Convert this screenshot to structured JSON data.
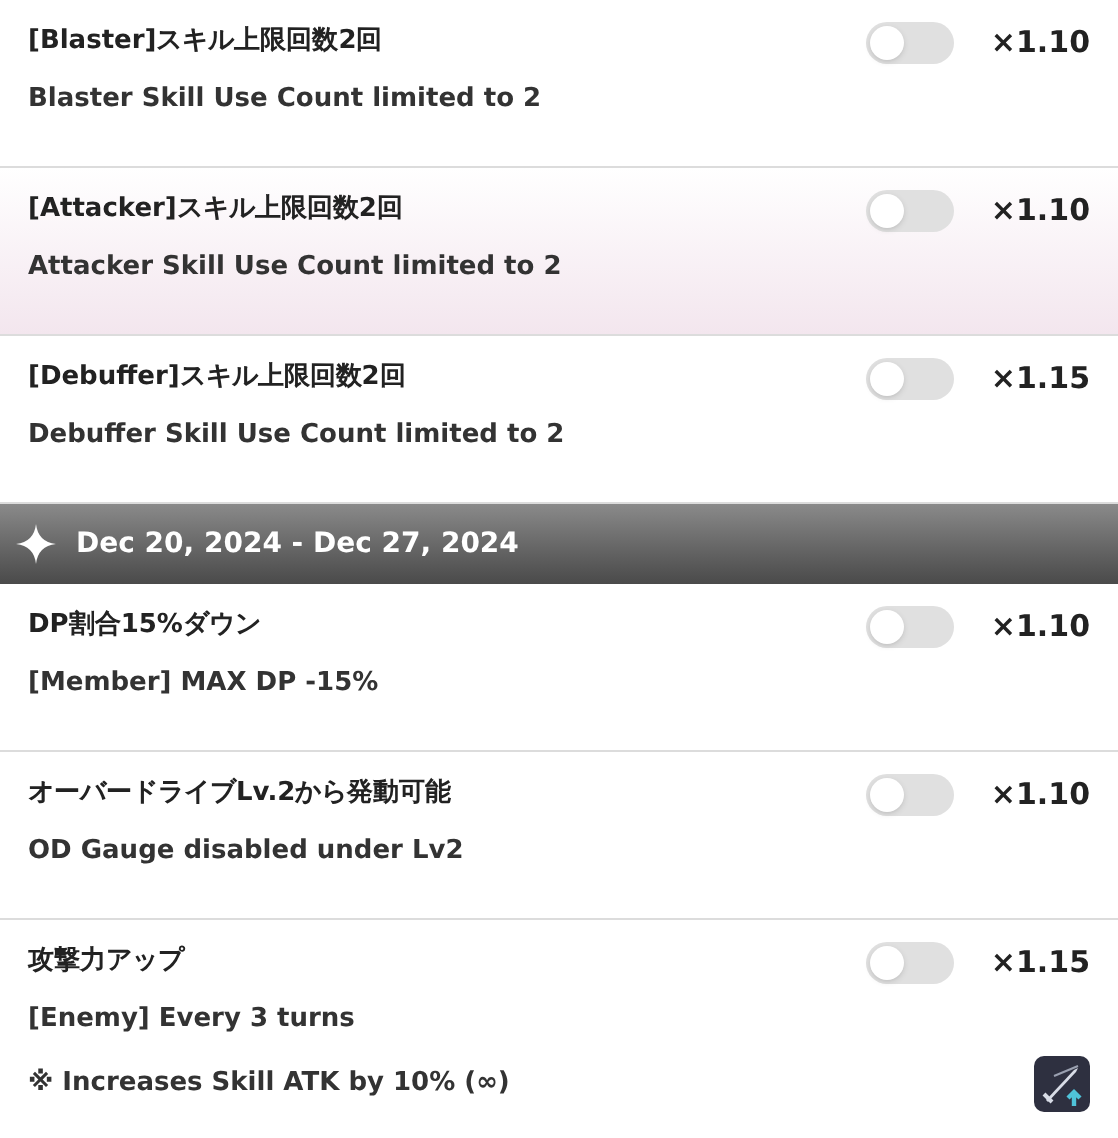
{
  "items": [
    {
      "kind": "option",
      "title": "[Blaster]スキル上限回数2回",
      "description": "Blaster Skill Use Count limited to 2",
      "multiplier": "×1.10",
      "on": false,
      "highlighted": false
    },
    {
      "kind": "option",
      "title": "[Attacker]スキル上限回数2回",
      "description": "Attacker Skill Use Count limited to 2",
      "multiplier": "×1.10",
      "on": false,
      "highlighted": true
    },
    {
      "kind": "option",
      "title": "[Debuffer]スキル上限回数2回",
      "description": "Debuffer Skill Use Count limited to 2",
      "multiplier": "×1.15",
      "on": false,
      "highlighted": false
    },
    {
      "kind": "header",
      "title": "Dec 20, 2024 - Dec 27, 2024"
    },
    {
      "kind": "option",
      "title": "DP割合15%ダウン",
      "description": "[Member] MAX DP -15%",
      "multiplier": "×1.10",
      "on": false,
      "highlighted": false
    },
    {
      "kind": "option",
      "title": "オーバードライブLv.2から発動可能",
      "description": "OD Gauge disabled under Lv2",
      "multiplier": "×1.10",
      "on": false,
      "highlighted": false
    },
    {
      "kind": "option",
      "title": "攻撃力アップ",
      "description": "[Enemy] Every 3 turns",
      "note": "※ Increases Skill ATK by 10% (∞)",
      "buff_icon": true,
      "multiplier": "×1.15",
      "on": false,
      "highlighted": false
    }
  ]
}
